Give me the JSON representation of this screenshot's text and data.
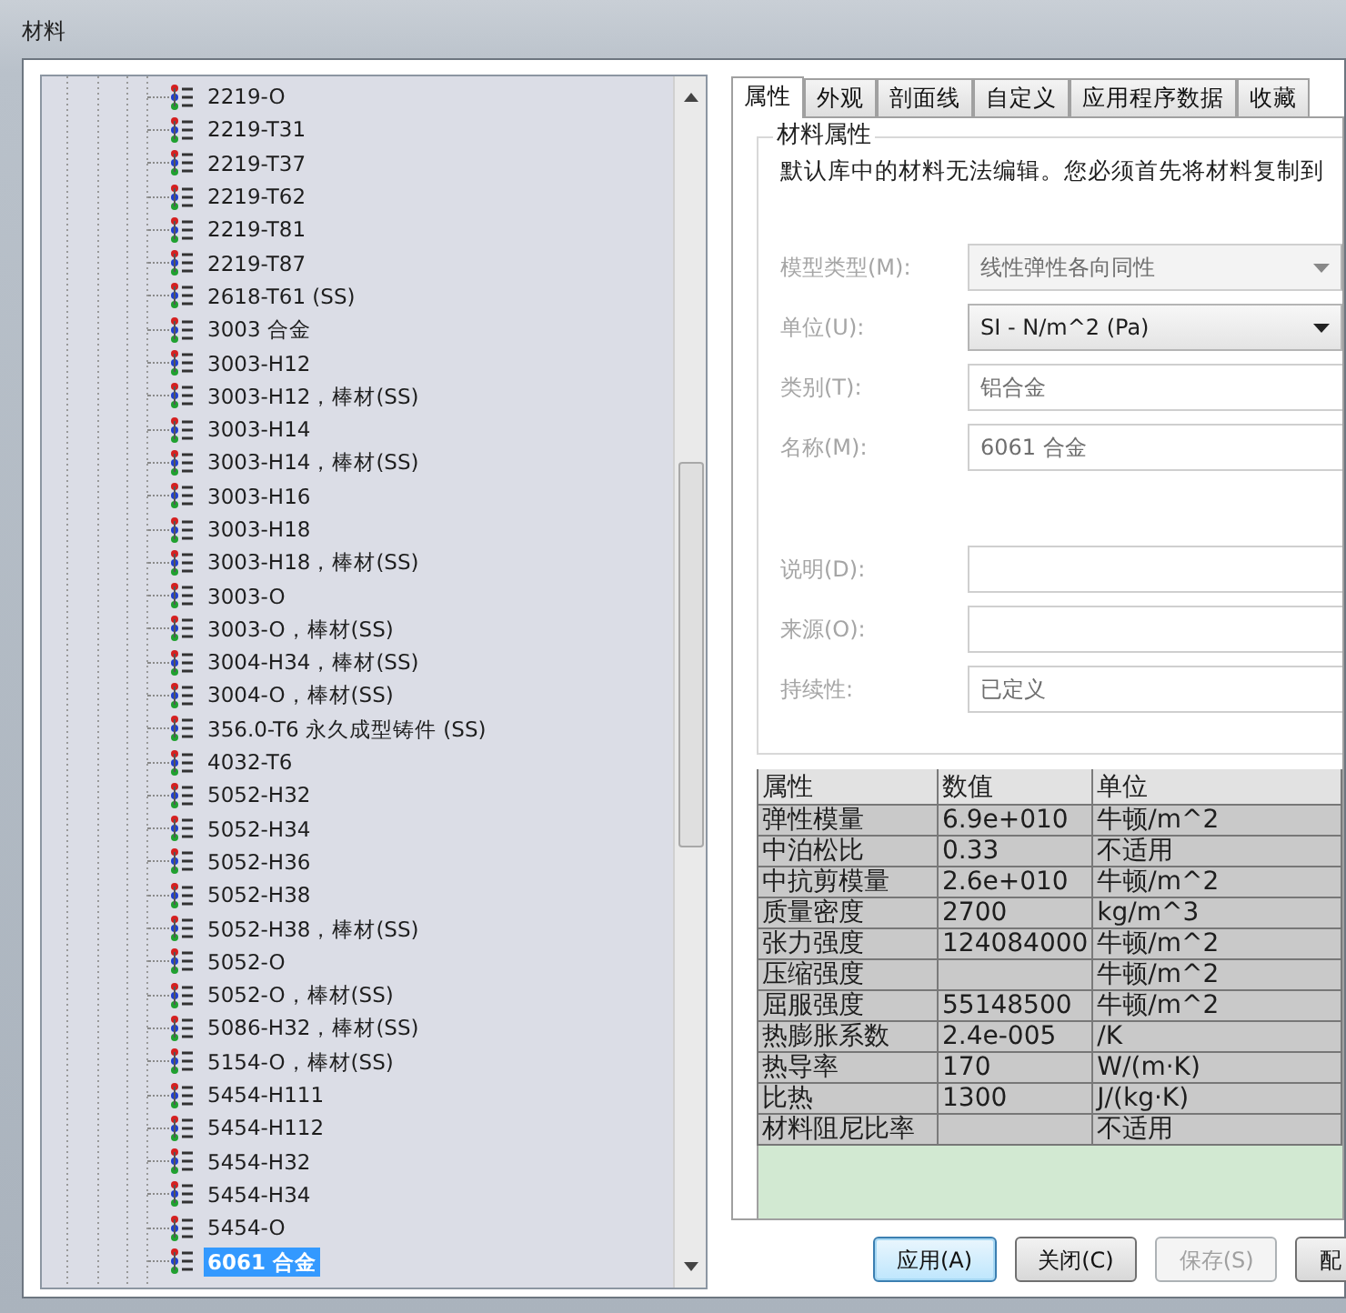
{
  "window": {
    "title": "材料"
  },
  "tree": {
    "items": [
      {
        "label": "2219-O",
        "selected": false
      },
      {
        "label": "2219-T31",
        "selected": false
      },
      {
        "label": "2219-T37",
        "selected": false
      },
      {
        "label": "2219-T62",
        "selected": false
      },
      {
        "label": "2219-T81",
        "selected": false
      },
      {
        "label": "2219-T87",
        "selected": false
      },
      {
        "label": "2618-T61 (SS)",
        "selected": false
      },
      {
        "label": "3003 合金",
        "selected": false
      },
      {
        "label": "3003-H12",
        "selected": false
      },
      {
        "label": "3003-H12，棒材(SS)",
        "selected": false
      },
      {
        "label": "3003-H14",
        "selected": false
      },
      {
        "label": "3003-H14，棒材(SS)",
        "selected": false
      },
      {
        "label": "3003-H16",
        "selected": false
      },
      {
        "label": "3003-H18",
        "selected": false
      },
      {
        "label": "3003-H18，棒材(SS)",
        "selected": false
      },
      {
        "label": "3003-O",
        "selected": false
      },
      {
        "label": "3003-O，棒材(SS)",
        "selected": false
      },
      {
        "label": "3004-H34，棒材(SS)",
        "selected": false
      },
      {
        "label": "3004-O，棒材(SS)",
        "selected": false
      },
      {
        "label": "356.0-T6 永久成型铸件 (SS)",
        "selected": false
      },
      {
        "label": "4032-T6",
        "selected": false
      },
      {
        "label": "5052-H32",
        "selected": false
      },
      {
        "label": "5052-H34",
        "selected": false
      },
      {
        "label": "5052-H36",
        "selected": false
      },
      {
        "label": "5052-H38",
        "selected": false
      },
      {
        "label": "5052-H38，棒材(SS)",
        "selected": false
      },
      {
        "label": "5052-O",
        "selected": false
      },
      {
        "label": "5052-O，棒材(SS)",
        "selected": false
      },
      {
        "label": "5086-H32，棒材(SS)",
        "selected": false
      },
      {
        "label": "5154-O，棒材(SS)",
        "selected": false
      },
      {
        "label": "5454-H111",
        "selected": false
      },
      {
        "label": "5454-H112",
        "selected": false
      },
      {
        "label": "5454-H32",
        "selected": false
      },
      {
        "label": "5454-H34",
        "selected": false
      },
      {
        "label": "5454-O",
        "selected": false
      },
      {
        "label": "6061 合金",
        "selected": true
      }
    ]
  },
  "tabs": [
    {
      "label": "属性",
      "selected": true
    },
    {
      "label": "外观",
      "selected": false
    },
    {
      "label": "剖面线",
      "selected": false
    },
    {
      "label": "自定义",
      "selected": false
    },
    {
      "label": "应用程序数据",
      "selected": false
    },
    {
      "label": "收藏",
      "selected": false
    }
  ],
  "group": {
    "title": "材料属性",
    "notice": "默认库中的材料无法编辑。您必须首先将材料复制到"
  },
  "fields": [
    {
      "kind": "combo",
      "label": "模型类型(M):",
      "value": "线性弹性各向同性",
      "disabled": true
    },
    {
      "kind": "combo",
      "label": "单位(U):",
      "value": "SI - N/m^2 (Pa)",
      "disabled": false
    },
    {
      "kind": "text",
      "label": "类别(T):",
      "value": "铝合金",
      "disabled": true
    },
    {
      "kind": "text",
      "label": "名称(M):",
      "value": "6061 合金",
      "disabled": true
    },
    {
      "kind": "spacer"
    },
    {
      "kind": "text",
      "label": "说明(D):",
      "disabled": true
    },
    {
      "kind": "text",
      "label": "来源(O):",
      "disabled": true
    },
    {
      "kind": "text",
      "label": "持续性:",
      "value": "已定义",
      "disabled": true
    }
  ],
  "table": {
    "columns": [
      "属性",
      "数值",
      "单位"
    ],
    "rows": [
      [
        "弹性模量",
        "6.9e+010",
        "牛顿/m^2"
      ],
      [
        "中泊松比",
        "0.33",
        "不适用"
      ],
      [
        "中抗剪模量",
        "2.6e+010",
        "牛顿/m^2"
      ],
      [
        "质量密度",
        "2700",
        "kg/m^3"
      ],
      [
        "张力强度",
        "124084000",
        "牛顿/m^2"
      ],
      [
        "压缩强度",
        "",
        "牛顿/m^2"
      ],
      [
        "屈服强度",
        "55148500",
        "牛顿/m^2"
      ],
      [
        "热膨胀系数",
        "2.4e-005",
        "/K"
      ],
      [
        "热导率",
        "170",
        "W/(m·K)"
      ],
      [
        "比热",
        "1300",
        "J/(kg·K)"
      ],
      [
        "材料阻尼比率",
        "",
        "不适用"
      ]
    ]
  },
  "buttons": [
    {
      "label": "应用(A)",
      "disabled": false,
      "focused": true
    },
    {
      "label": "关闭(C)",
      "disabled": false,
      "focused": false
    },
    {
      "label": "保存(S)",
      "disabled": true,
      "focused": false
    },
    {
      "label": "配",
      "disabled": false,
      "focused": false
    }
  ]
}
